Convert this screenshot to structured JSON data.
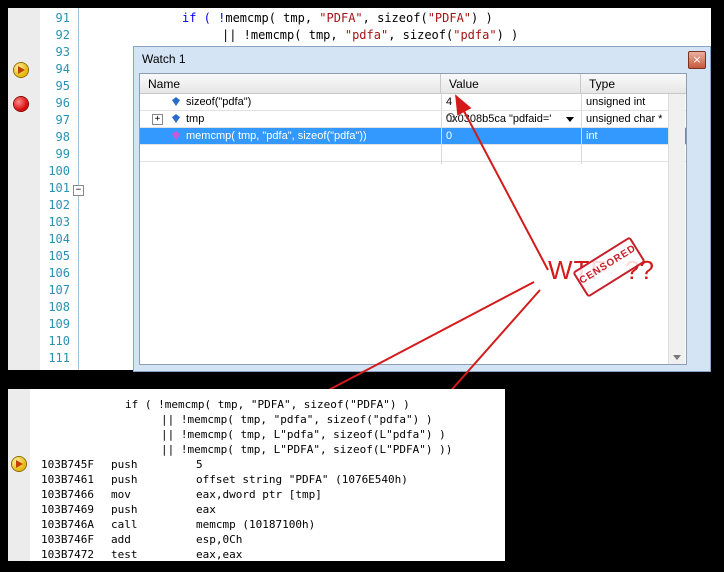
{
  "editor": {
    "line_numbers": [
      "91",
      "92",
      "93",
      "94",
      "95",
      "96",
      "97",
      "98",
      "99",
      "100",
      "101",
      "102",
      "103",
      "104",
      "105",
      "106",
      "107",
      "108",
      "109",
      "110",
      "111"
    ],
    "code_line_91": {
      "p1": "if ( !",
      "p2": "memcmp",
      "p3": "( tmp, ",
      "s1": "\"PDFA\"",
      "p4": ", sizeof(",
      "s2": "\"PDFA\"",
      "p5": ") )"
    },
    "code_line_92": {
      "p1": "|| !",
      "p2": "memcmp",
      "p3": "( tmp, ",
      "s1": "\"pdfa\"",
      "p4": ", sizeof(",
      "s2": "\"pdfa\"",
      "p5": ") )"
    }
  },
  "watch": {
    "title": "Watch 1",
    "close_glyph": "×",
    "columns": {
      "name": "Name",
      "value": "Value",
      "type": "Type"
    },
    "rows": [
      {
        "name": "sizeof(\"pdfa\")",
        "value": "4",
        "type": "unsigned int"
      },
      {
        "expand": "+",
        "name": "tmp",
        "value": "0x0308b5ca \"pdfaid='h",
        "type": "unsigned char *"
      },
      {
        "name": "memcmp( tmp, \"pdfa\", sizeof(\"pdfa\"))",
        "value": "0",
        "type": "int"
      }
    ]
  },
  "annotation": {
    "text": "WTF",
    "suffix": "??",
    "stamp": "CENSORED",
    "color": "#d31b1b"
  },
  "disasm": {
    "source": [
      "if ( !memcmp( tmp, \"PDFA\", sizeof(\"PDFA\") )",
      "|| !memcmp( tmp, \"pdfa\", sizeof(\"pdfa\") )",
      "|| !memcmp( tmp, L\"pdfa\", sizeof(L\"pdfa\") )",
      "|| !memcmp( tmp, L\"PDFA\", sizeof(L\"PDFA\") ))"
    ],
    "instructions": [
      {
        "addr": "103B745F",
        "op": "push",
        "arg": "5"
      },
      {
        "addr": "103B7461",
        "op": "push",
        "arg": "offset string \"PDFA\" (1076E540h)"
      },
      {
        "addr": "103B7466",
        "op": "mov",
        "arg": "eax,dword ptr [tmp]"
      },
      {
        "addr": "103B7469",
        "op": "push",
        "arg": "eax"
      },
      {
        "addr": "103B746A",
        "op": "call",
        "arg": "memcmp (10187100h)"
      },
      {
        "addr": "103B746F",
        "op": "add",
        "arg": "esp,0Ch"
      },
      {
        "addr": "103B7472",
        "op": "test",
        "arg": "eax,eax"
      }
    ]
  }
}
